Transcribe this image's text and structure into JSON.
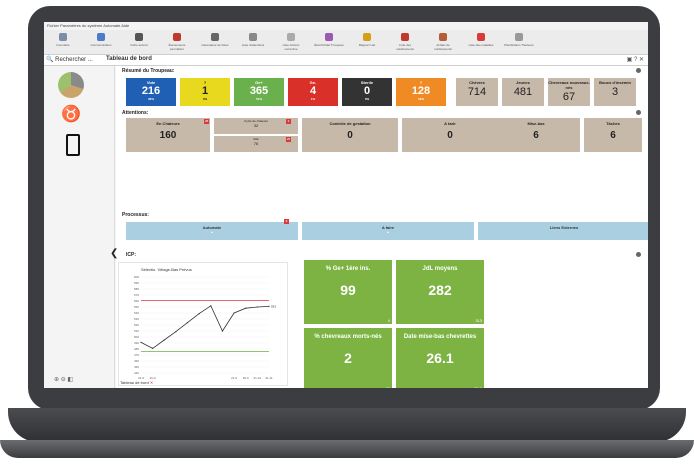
{
  "menu": "Fichier  Paramètres du système  Automate  Aide",
  "toolbar": [
    {
      "label": "Inventaire",
      "icon": "grid-icon"
    },
    {
      "label": "Communication",
      "icon": "antenna-icon"
    },
    {
      "label": "Fiche animal",
      "icon": "goat-icon"
    },
    {
      "label": "Évènements journaliers",
      "icon": "calendar-icon"
    },
    {
      "label": "Générateur de listes",
      "icon": "list-icon"
    },
    {
      "label": "Liste d'attentions",
      "icon": "bell-icon"
    },
    {
      "label": "Liste Actions corrective",
      "icon": "wrench-icon"
    },
    {
      "label": "État Perfdét Troupeau",
      "icon": "chart-icon"
    },
    {
      "label": "Rapport Lait",
      "icon": "milk-icon"
    },
    {
      "label": "Liste des médicaments",
      "icon": "medicine-icon"
    },
    {
      "label": "Achats de médicaments",
      "icon": "cart-icon"
    },
    {
      "label": "Liste des maladies",
      "icon": "cross-icon"
    },
    {
      "label": "Planification Tracteurs",
      "icon": "tractor-icon"
    }
  ],
  "search_label": "Rechercher ...",
  "tab_title": "Tableau de bord",
  "summary_title": "Résumé du Troupeau:",
  "summary_tiles": [
    {
      "label": "Vide",
      "value": "216",
      "pct": "30%",
      "color": "#1f5fb4"
    },
    {
      "label": "?",
      "value": "1",
      "pct": "0%",
      "color": "#e8d81e"
    },
    {
      "label": "Ge+",
      "value": "365",
      "pct": "51%",
      "color": "#6ab04c"
    },
    {
      "label": "Ge-",
      "value": "4",
      "pct": "1%",
      "color": "#d9302a"
    },
    {
      "label": "Sterile",
      "value": "0",
      "pct": "0%",
      "color": "#333333"
    },
    {
      "label": "?",
      "value": "128",
      "pct": "18%",
      "color": "#f08a24"
    }
  ],
  "brown_tiles": [
    {
      "label": "Chèvres",
      "value": "714"
    },
    {
      "label": "Jeunes",
      "value": "481"
    },
    {
      "label": "Chevreaux nouveaux-nés",
      "value": "67"
    },
    {
      "label": "Boucs d'insémin",
      "value": "3"
    }
  ],
  "attentions_title": "Attentions:",
  "attention_tiles": [
    {
      "label": "En Chaleurs",
      "value": "160",
      "badge": "28"
    },
    {
      "label": "Contrôle de gestation",
      "value": "0"
    },
    {
      "label": "A tarir",
      "value": "0"
    },
    {
      "label": "Mise-bas",
      "value": "6"
    },
    {
      "label": "Tâches",
      "value": "6"
    }
  ],
  "cycle_tiles": [
    {
      "label": "Cycle de chaleurs",
      "value": "32",
      "badge": "3"
    },
    {
      "label": "Vide",
      "value": "76",
      "badge": "25"
    }
  ],
  "process_title": "Processus:",
  "process_tiles": [
    {
      "label": "Automate",
      "badge": "3"
    },
    {
      "label": "A faire"
    },
    {
      "label": "Liens Externes"
    }
  ],
  "icp_title": "ICP:",
  "chart_data": {
    "type": "line",
    "title": "Sélectio. Vêlage-Bas Prévus",
    "xlabel": "",
    "ylabel": "",
    "x": [
      "31-9",
      "30-9",
      "",
      "",
      "",
      "",
      "",
      "",
      "21-9",
      "30-9",
      "31-10",
      "31-11"
    ],
    "series": [
      {
        "values": [
          491,
          481,
          495,
          509,
          524,
          539,
          552,
          510,
          540,
          548,
          550,
          551
        ],
        "color": "#333333"
      }
    ],
    "upper_line": 561,
    "lower_line": 476,
    "end_label": "553",
    "ylim": [
      440,
      600
    ]
  },
  "kpis": [
    {
      "label": "% Ge+ 1ère ins.",
      "value": "99",
      "sub": "4"
    },
    {
      "label": "JdL moyens",
      "value": "282",
      "sub": "313"
    },
    {
      "label": "% chevreaux morts-nés",
      "value": "2",
      "sub": "32"
    },
    {
      "label": "Date mise-bas chevrettes",
      "value": "26.1",
      "sub": "23.2"
    }
  ],
  "footer_tab": "Tableau de bord"
}
